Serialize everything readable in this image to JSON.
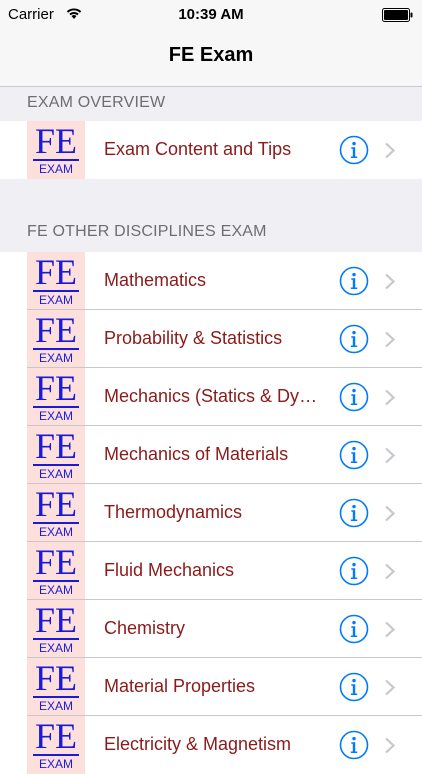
{
  "status_bar": {
    "carrier": "Carrier",
    "time": "10:39 AM"
  },
  "nav": {
    "title": "FE Exam"
  },
  "logo": {
    "fe_text": "FE",
    "exam_text": "EXAM"
  },
  "sections": [
    {
      "header": "EXAM OVERVIEW",
      "items": [
        {
          "label": "Exam Content and Tips"
        }
      ]
    },
    {
      "header": "FE OTHER DISCIPLINES EXAM",
      "items": [
        {
          "label": "Mathematics"
        },
        {
          "label": "Probability & Statistics"
        },
        {
          "label": "Mechanics (Statics & Dynamics)"
        },
        {
          "label": "Mechanics of Materials"
        },
        {
          "label": "Thermodynamics"
        },
        {
          "label": "Fluid Mechanics"
        },
        {
          "label": "Chemistry"
        },
        {
          "label": "Material Properties"
        },
        {
          "label": "Electricity & Magnetism"
        }
      ]
    }
  ],
  "colors": {
    "label": "#8b1a1a",
    "accent": "#007aff",
    "logo_bg": "#fde0dc",
    "logo_text": "#1a1adb",
    "chevron": "#c7c7cc"
  },
  "icons": {
    "info": "info-circle-icon",
    "chevron": "chevron-right-icon",
    "wifi": "wifi-icon",
    "battery": "battery-icon"
  }
}
